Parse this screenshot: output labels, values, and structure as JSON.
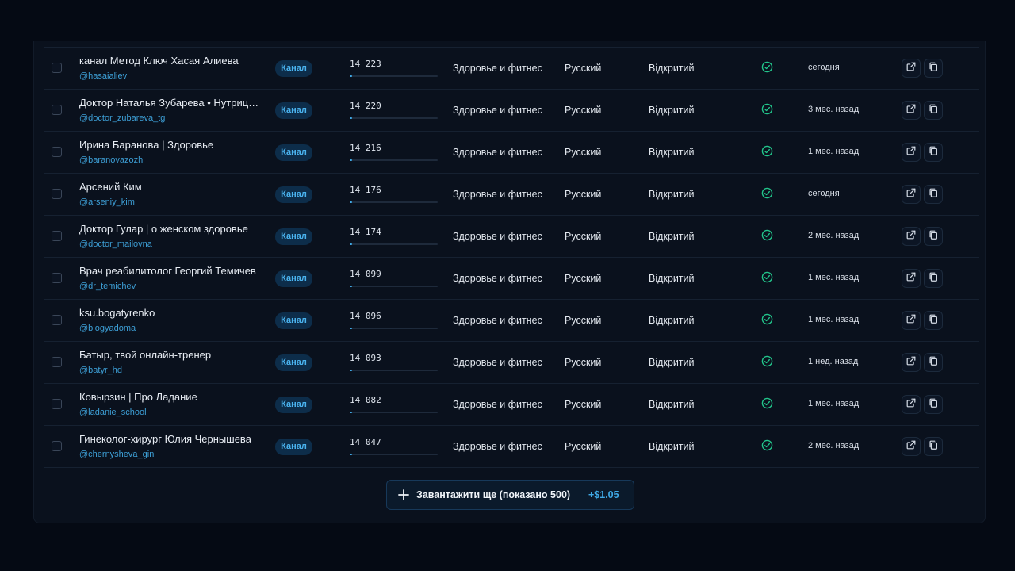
{
  "rows": [
    {
      "name": "канал Метод Ключ Хасая Алиева",
      "handle": "@hasaialiev",
      "type": "Канал",
      "subscribers": "14 223",
      "subs_fill": 0.03,
      "category": "Здоровье и фитнес",
      "language": "Русский",
      "access": "Відкритий",
      "verified": true,
      "updated": "сегодня"
    },
    {
      "name": "Доктор Наталья Зубарева • Нутрициолог",
      "handle": "@doctor_zubareva_tg",
      "type": "Канал",
      "subscribers": "14 220",
      "subs_fill": 0.03,
      "category": "Здоровье и фитнес",
      "language": "Русский",
      "access": "Відкритий",
      "verified": true,
      "updated": "3 мес. назад"
    },
    {
      "name": "Ирина Баранова | Здоровье",
      "handle": "@baranovazozh",
      "type": "Канал",
      "subscribers": "14 216",
      "subs_fill": 0.03,
      "category": "Здоровье и фитнес",
      "language": "Русский",
      "access": "Відкритий",
      "verified": true,
      "updated": "1 мес. назад"
    },
    {
      "name": "Арсений Ким",
      "handle": "@arseniy_kim",
      "type": "Канал",
      "subscribers": "14 176",
      "subs_fill": 0.03,
      "category": "Здоровье и фитнес",
      "language": "Русский",
      "access": "Відкритий",
      "verified": true,
      "updated": "сегодня"
    },
    {
      "name": "Доктор Гулар | о женском здоровье",
      "handle": "@doctor_mailovna",
      "type": "Канал",
      "subscribers": "14 174",
      "subs_fill": 0.03,
      "category": "Здоровье и фитнес",
      "language": "Русский",
      "access": "Відкритий",
      "verified": true,
      "updated": "2 мес. назад"
    },
    {
      "name": "Врач реабилитолог Георгий Темичев",
      "handle": "@dr_temichev",
      "type": "Канал",
      "subscribers": "14 099",
      "subs_fill": 0.03,
      "category": "Здоровье и фитнес",
      "language": "Русский",
      "access": "Відкритий",
      "verified": true,
      "updated": "1 мес. назад"
    },
    {
      "name": "ksu.bogatyrenko",
      "handle": "@blogyadoma",
      "type": "Канал",
      "subscribers": "14 096",
      "subs_fill": 0.03,
      "category": "Здоровье и фитнес",
      "language": "Русский",
      "access": "Відкритий",
      "verified": true,
      "updated": "1 мес. назад"
    },
    {
      "name": "Батыр, твой онлайн-тренер",
      "handle": "@batyr_hd",
      "type": "Канал",
      "subscribers": "14 093",
      "subs_fill": 0.03,
      "category": "Здоровье и фитнес",
      "language": "Русский",
      "access": "Відкритий",
      "verified": true,
      "updated": "1 нед. назад"
    },
    {
      "name": "Ковырзин | Про Ладание",
      "handle": "@ladanie_school",
      "type": "Канал",
      "subscribers": "14 082",
      "subs_fill": 0.03,
      "category": "Здоровье и фитнес",
      "language": "Русский",
      "access": "Відкритий",
      "verified": true,
      "updated": "1 мес. назад"
    },
    {
      "name": "Гинеколог-хирург Юлия Чернышева",
      "handle": "@chernysheva_gin",
      "type": "Канал",
      "subscribers": "14 047",
      "subs_fill": 0.03,
      "category": "Здоровье и фитнес",
      "language": "Русский",
      "access": "Відкритий",
      "verified": true,
      "updated": "2 мес. назад"
    }
  ],
  "load_more": {
    "label": "Завантажити ще (показано 500)",
    "price": "+$1.05",
    "icon": "plus-icon"
  },
  "colors": {
    "background": "#050a14",
    "panel": "#0a111d",
    "accent": "#3fa9e6",
    "verified": "#22c58b",
    "badge_bg": "#0d2d4a"
  },
  "icons": {
    "verified": "check-circle-icon",
    "open": "external-link-icon",
    "copy": "copy-icon"
  }
}
